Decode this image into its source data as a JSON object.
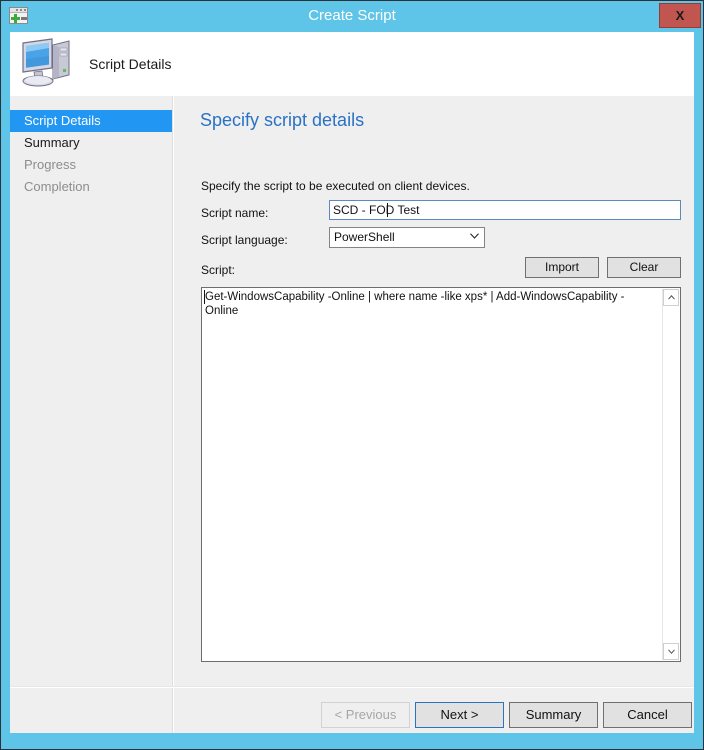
{
  "window": {
    "title": "Create Script",
    "icon": "create-script-window-icon",
    "close_label": "X"
  },
  "header": {
    "title": "Script Details",
    "icon": "computer-icon"
  },
  "sidebar": {
    "items": [
      {
        "label": "Script Details",
        "state": "selected"
      },
      {
        "label": "Summary",
        "state": "enabled"
      },
      {
        "label": "Progress",
        "state": "disabled"
      },
      {
        "label": "Completion",
        "state": "disabled"
      }
    ]
  },
  "content": {
    "heading": "Specify script details",
    "intro": "Specify the script to be executed on client devices.",
    "fields": {
      "script_name": {
        "label": "Script name:",
        "value": "SCD - FOD Test",
        "placeholder": ""
      },
      "script_language": {
        "label": "Script language:",
        "value": "PowerShell",
        "options": [
          "PowerShell"
        ]
      },
      "script": {
        "label": "Script:",
        "value": "Get-WindowsCapability -Online | where name -like xps* | Add-WindowsCapability -Online"
      }
    },
    "actions": {
      "import_label": "Import",
      "clear_label": "Clear"
    }
  },
  "footer": {
    "previous_label": "< Previous",
    "next_label": "Next >",
    "summary_label": "Summary",
    "cancel_label": "Cancel"
  },
  "colors": {
    "accent": "#5ec4e8",
    "heading": "#2a72c4",
    "selection": "#2196f3",
    "close": "#c0564f"
  }
}
